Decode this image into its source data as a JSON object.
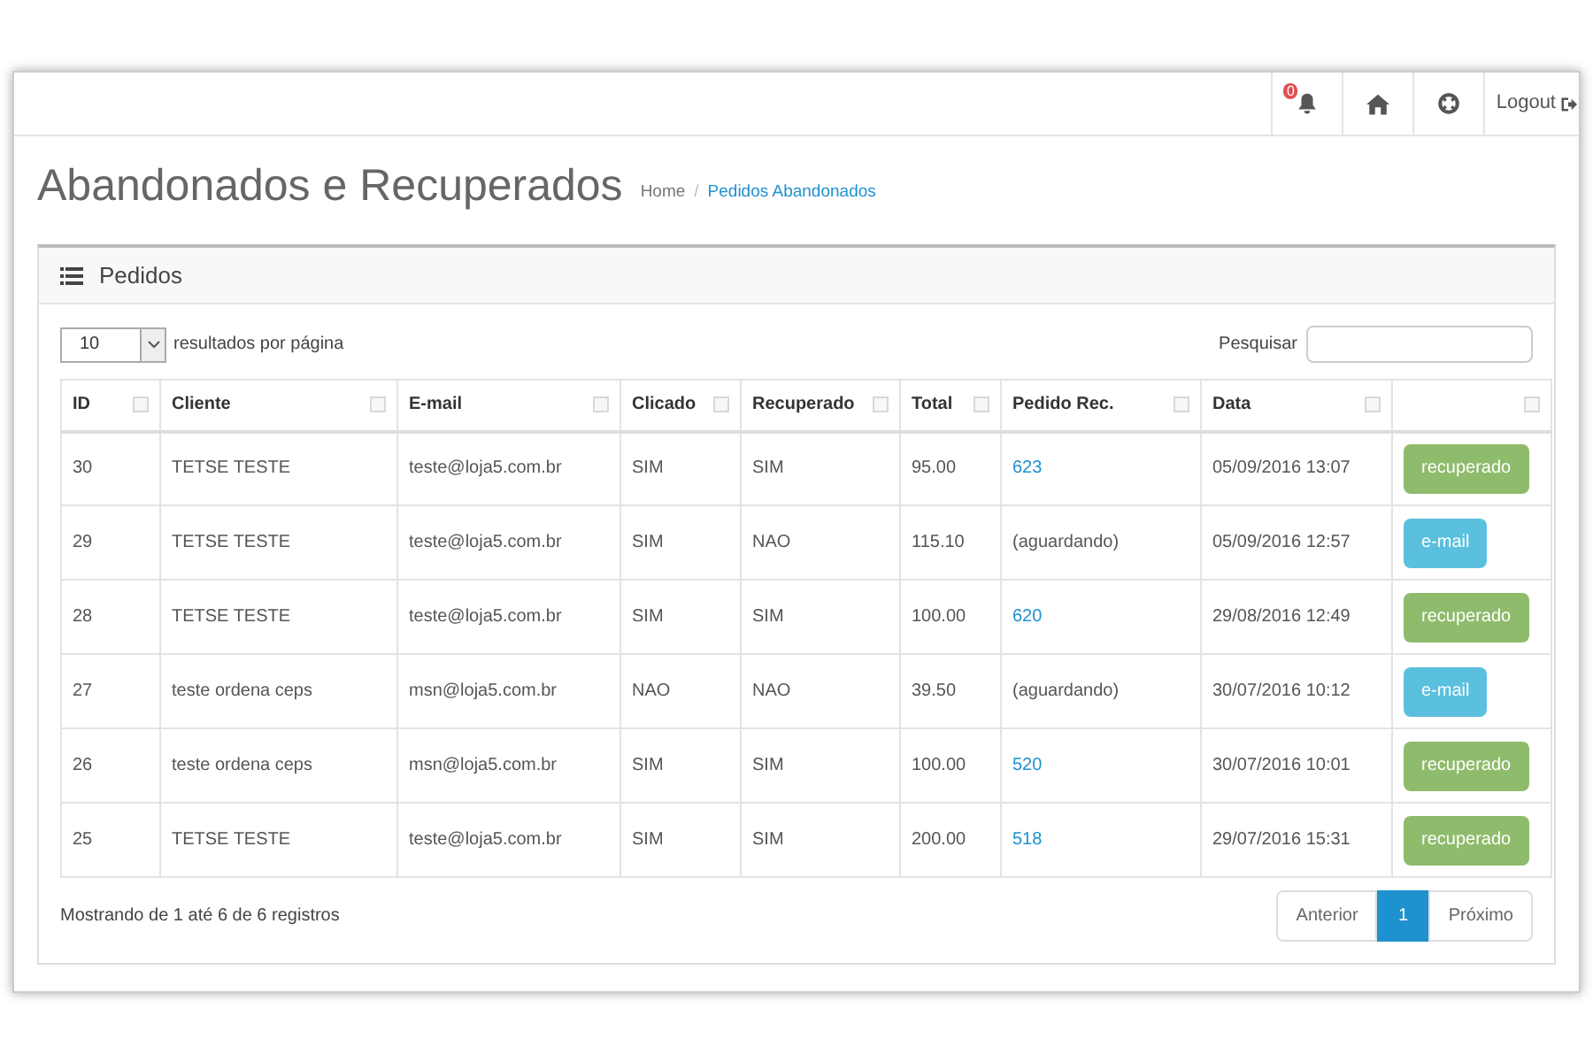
{
  "topbar": {
    "notification_count": "0",
    "logout": "Logout"
  },
  "header": {
    "title": "Abandonados e Recuperados",
    "breadcrumb_separator": "/",
    "breadcrumb": [
      {
        "label": "Home",
        "selected": false
      },
      {
        "label": "Pedidos Abandonados",
        "selected": true
      }
    ]
  },
  "panel": {
    "title": "Pedidos"
  },
  "length_select": {
    "value": "10",
    "label": "resultados por página"
  },
  "search": {
    "label": "Pesquisar"
  },
  "table": {
    "columns": [
      "ID",
      "Cliente",
      "E-mail",
      "Clicado",
      "Recuperado",
      "Total",
      "Pedido Rec.",
      "Data"
    ],
    "rows": [
      {
        "id": "30",
        "cliente": "TETSE TESTE",
        "email": "teste@loja5.com.br",
        "clicado": "SIM",
        "recuperado": "SIM",
        "total": "95.00",
        "pedido": "623",
        "pedido_linked": true,
        "data": "05/09/2016 13:07",
        "action": {
          "kind": "recovered",
          "label": "recuperado"
        }
      },
      {
        "id": "29",
        "cliente": "TETSE TESTE",
        "email": "teste@loja5.com.br",
        "clicado": "SIM",
        "recuperado": "NAO",
        "total": "115.10",
        "pedido": "(aguardando)",
        "pedido_linked": false,
        "data": "05/09/2016 12:57",
        "action": {
          "kind": "email",
          "label": "e-mail"
        }
      },
      {
        "id": "28",
        "cliente": "TETSE TESTE",
        "email": "teste@loja5.com.br",
        "clicado": "SIM",
        "recuperado": "SIM",
        "total": "100.00",
        "pedido": "620",
        "pedido_linked": true,
        "data": "29/08/2016 12:49",
        "action": {
          "kind": "recovered",
          "label": "recuperado"
        }
      },
      {
        "id": "27",
        "cliente": "teste ordena ceps",
        "email": "msn@loja5.com.br",
        "clicado": "NAO",
        "recuperado": "NAO",
        "total": "39.50",
        "pedido": "(aguardando)",
        "pedido_linked": false,
        "data": "30/07/2016 10:12",
        "action": {
          "kind": "email",
          "label": "e-mail"
        }
      },
      {
        "id": "26",
        "cliente": "teste ordena ceps",
        "email": "msn@loja5.com.br",
        "clicado": "SIM",
        "recuperado": "SIM",
        "total": "100.00",
        "pedido": "520",
        "pedido_linked": true,
        "data": "30/07/2016 10:01",
        "action": {
          "kind": "recovered",
          "label": "recuperado"
        }
      },
      {
        "id": "25",
        "cliente": "TETSE TESTE",
        "email": "teste@loja5.com.br",
        "clicado": "SIM",
        "recuperado": "SIM",
        "total": "200.00",
        "pedido": "518",
        "pedido_linked": true,
        "data": "29/07/2016 15:31",
        "action": {
          "kind": "recovered",
          "label": "recuperado"
        }
      }
    ]
  },
  "info": "Mostrando de 1 até 6 de 6 registros",
  "pagination": {
    "previous": "Anterior",
    "pages": [
      {
        "label": "1",
        "selected": true
      }
    ],
    "next": "Próximo"
  }
}
